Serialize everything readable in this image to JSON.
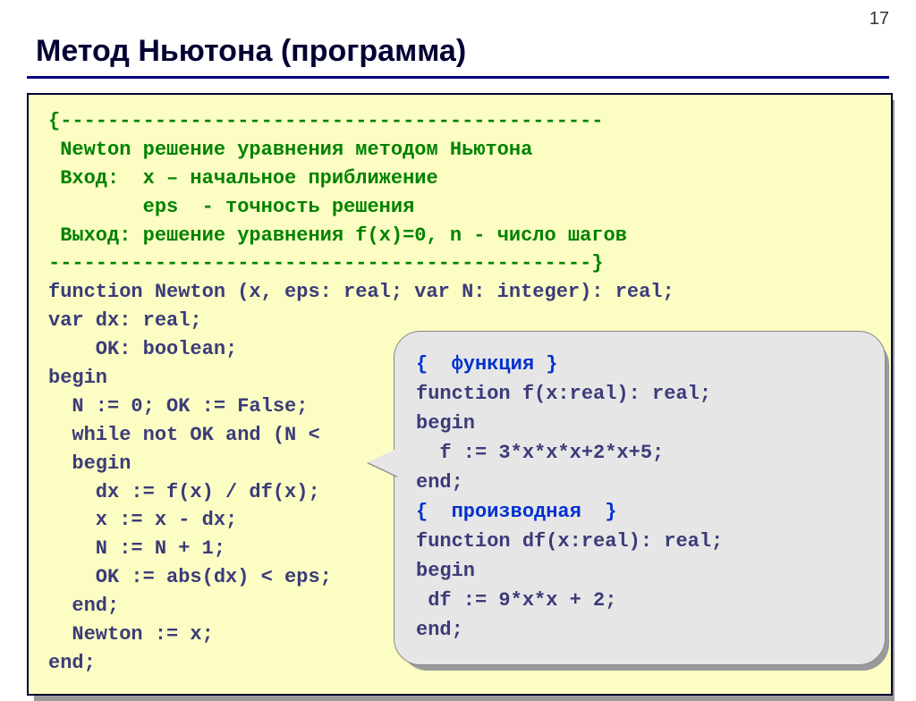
{
  "page_number": "17",
  "title": "Метод Ньютона (программа)",
  "code": {
    "comment_open": "{----------------------------------------------",
    "comment_l1": " Newton решение уравнения методом Ньютона",
    "comment_l2": " Вход:  x – начальное приближение",
    "comment_l3": "        eps  - точность решения",
    "comment_l4": " Выход: решение уравнения f(x)=0, n - число шагов",
    "comment_close": "----------------------------------------------}",
    "b1": "function Newton (x, eps: real; var N: integer): real;",
    "b2": "var dx: real;",
    "b3": "    OK: boolean;",
    "b4": "begin",
    "b5": "  N := 0; OK := False;",
    "b6": "  while not OK and (N <",
    "b7": "  begin",
    "b8": "    dx := f(x) / df(x);",
    "b9": "    x := x - dx;",
    "b10": "    N := N + 1;",
    "b11": "    OK := abs(dx) < eps;",
    "b12": "  end;",
    "b13": "  Newton := x;",
    "b14": "end;"
  },
  "bubble": {
    "c1": "{  функция }",
    "l1": "function f(x:real): real;",
    "l2": "begin",
    "l3": "  f := 3*x*x*x+2*x+5;",
    "l4": "end;",
    "c2": "{  производная  }",
    "l5": "function df(x:real): real;",
    "l6": "begin",
    "l7": " df := 9*x*x + 2;",
    "l8": "end;"
  }
}
